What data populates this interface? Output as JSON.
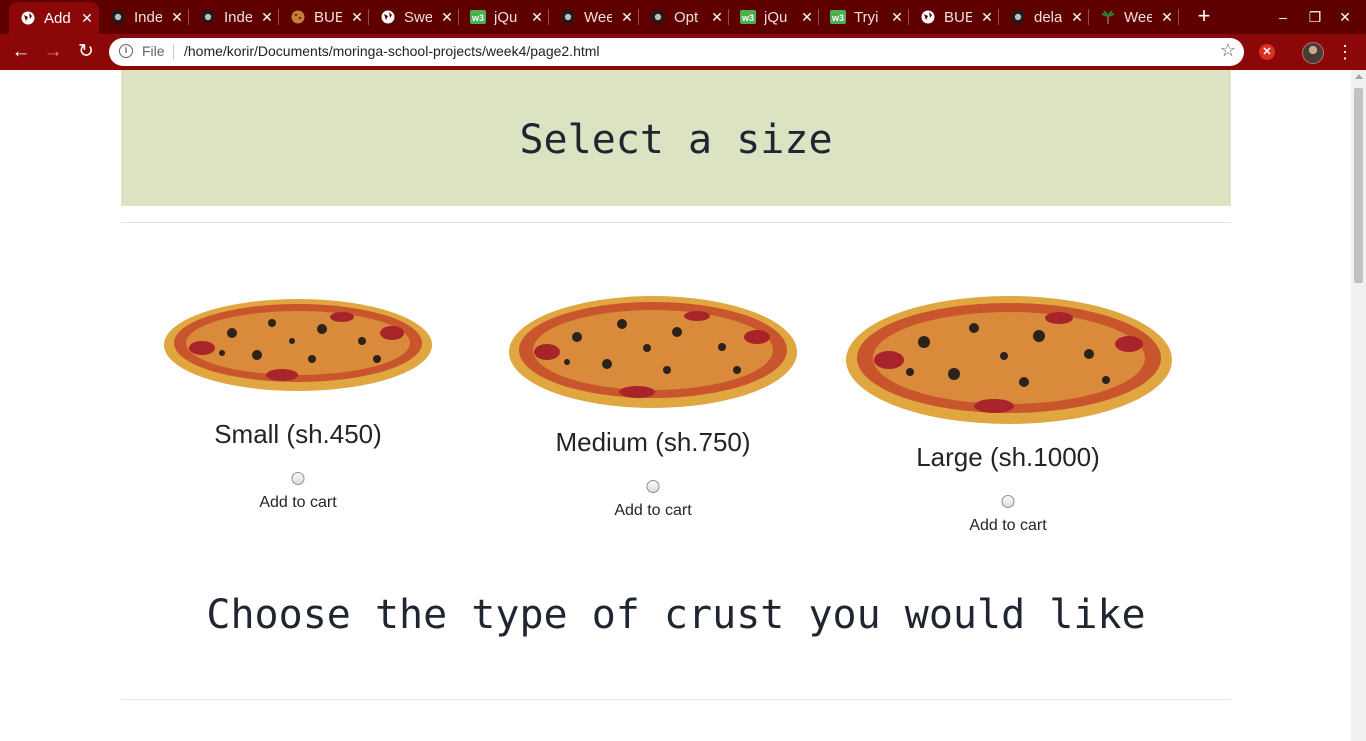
{
  "browser": {
    "tabs": [
      {
        "title": "Add",
        "icon": "globe-icon",
        "active": true
      },
      {
        "title": "Inde",
        "icon": "github-icon"
      },
      {
        "title": "Inde",
        "icon": "github-icon"
      },
      {
        "title": "BUE",
        "icon": "cookie-icon"
      },
      {
        "title": "Swe",
        "icon": "globe-icon"
      },
      {
        "title": "jQu",
        "icon": "w3-icon"
      },
      {
        "title": "Wee",
        "icon": "github-icon"
      },
      {
        "title": "Opt",
        "icon": "github-icon"
      },
      {
        "title": "jQu",
        "icon": "w3-icon"
      },
      {
        "title": "Tryi",
        "icon": "w3-icon"
      },
      {
        "title": "BUE",
        "icon": "globe-icon"
      },
      {
        "title": "dela",
        "icon": "github-icon"
      },
      {
        "title": "Wee",
        "icon": "palm-icon"
      }
    ],
    "address": {
      "scheme_label": "File",
      "url": "/home/korir/Documents/moringa-school-projects/week4/page2.html"
    },
    "colors": {
      "tabbar": "#5e0000",
      "toolbar": "#8c0707"
    }
  },
  "page": {
    "heading": "Select a size",
    "sizes": [
      {
        "label": "Small (sh.450)",
        "action": "Add to cart"
      },
      {
        "label": "Medium (sh.750)",
        "action": "Add to cart"
      },
      {
        "label": "Large (sh.1000)",
        "action": "Add to cart"
      }
    ],
    "crust_heading": "Choose the type of crust you would like",
    "colors": {
      "jumbotron": "#dce3c3",
      "text": "#212529"
    }
  }
}
